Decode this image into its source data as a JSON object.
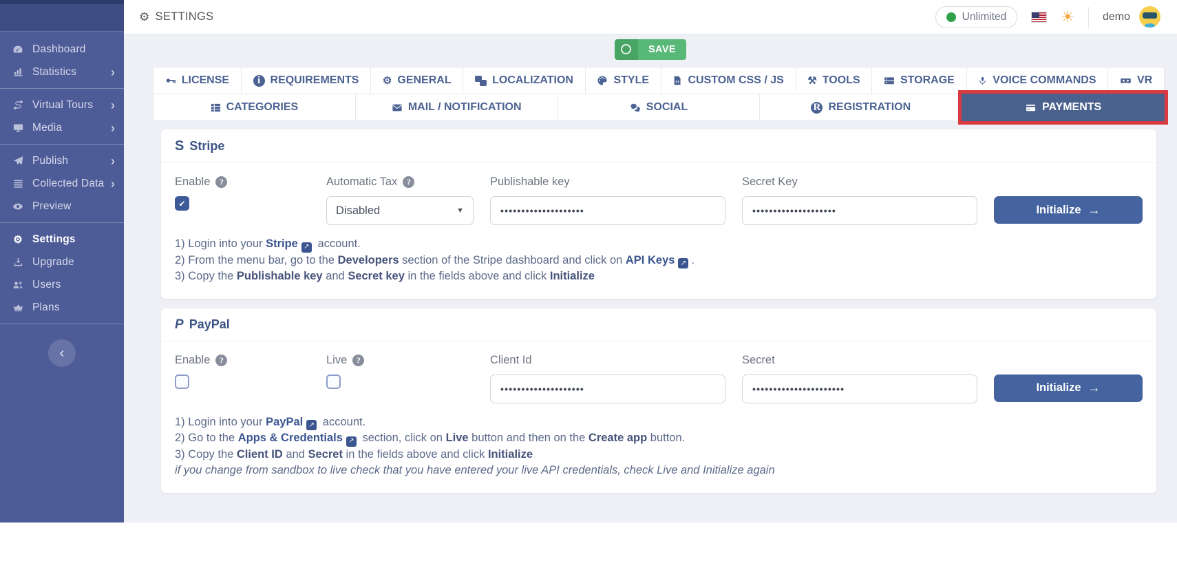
{
  "app": {
    "title": "SETTINGS"
  },
  "colors": {
    "sidebar_bg": "#4d5b97",
    "accent_blue": "#45639e",
    "active_tab_bg": "#4a618e",
    "highlight_red": "#d93a40",
    "save_green": "#57b878",
    "badge_green": "#31a24c",
    "sun_orange": "#f0a63c"
  },
  "header": {
    "plan_badge": "Unlimited",
    "username": "demo",
    "icons": [
      "flag-us-icon",
      "sun-icon",
      "avatar"
    ]
  },
  "toolbar": {
    "save_label": "SAVE",
    "save_icon": "circle-outline-icon"
  },
  "sidebar": {
    "items": [
      {
        "label": "Dashboard",
        "icon": "dashboard-icon",
        "has_submenu": false,
        "active": false
      },
      {
        "label": "Statistics",
        "icon": "statistics-icon",
        "has_submenu": true,
        "active": false
      },
      {
        "label": "Virtual Tours",
        "icon": "route-icon",
        "has_submenu": true,
        "active": false
      },
      {
        "label": "Media",
        "icon": "monitor-icon",
        "has_submenu": true,
        "active": false
      },
      {
        "label": "Publish",
        "icon": "paper-plane-icon",
        "has_submenu": true,
        "active": false
      },
      {
        "label": "Collected Data",
        "icon": "list-icon",
        "has_submenu": true,
        "active": false
      },
      {
        "label": "Preview",
        "icon": "eye-icon",
        "has_submenu": false,
        "active": false
      },
      {
        "label": "Settings",
        "icon": "gears-icon",
        "has_submenu": false,
        "active": true
      },
      {
        "label": "Upgrade",
        "icon": "download-icon",
        "has_submenu": false,
        "active": false
      },
      {
        "label": "Users",
        "icon": "users-icon",
        "has_submenu": false,
        "active": false
      },
      {
        "label": "Plans",
        "icon": "crown-icon",
        "has_submenu": false,
        "active": false
      }
    ],
    "chevron_glyph": "›",
    "collapse_glyph": "‹"
  },
  "tabs_row1": [
    {
      "label": "LICENSE",
      "icon": "key-icon"
    },
    {
      "label": "REQUIREMENTS",
      "icon": "info-circle-icon"
    },
    {
      "label": "GENERAL",
      "icon": "gears-icon"
    },
    {
      "label": "LOCALIZATION",
      "icon": "language-icon"
    },
    {
      "label": "STYLE",
      "icon": "palette-icon"
    },
    {
      "label": "CUSTOM CSS / JS",
      "icon": "file-code-icon"
    },
    {
      "label": "TOOLS",
      "icon": "tools-icon"
    },
    {
      "label": "STORAGE",
      "icon": "server-icon"
    },
    {
      "label": "VOICE COMMANDS",
      "icon": "microphone-icon"
    },
    {
      "label": "VR",
      "icon": "vr-headset-icon"
    }
  ],
  "tabs_row2": [
    {
      "label": "CATEGORIES",
      "icon": "grid-list-icon",
      "active": false
    },
    {
      "label": "MAIL / NOTIFICATION",
      "icon": "mail-icon",
      "active": false
    },
    {
      "label": "SOCIAL",
      "icon": "comments-icon",
      "active": false
    },
    {
      "label": "REGISTRATION",
      "icon": "registered-icon",
      "active": false
    },
    {
      "label": "PAYMENTS",
      "icon": "credit-card-icon",
      "active": true,
      "highlight": "red-annotation-ring"
    }
  ],
  "stripe": {
    "title": "Stripe",
    "enable_label": "Enable",
    "enable_checked": true,
    "automatic_tax_label": "Automatic Tax",
    "automatic_tax_value": "Disabled",
    "publishable_key_label": "Publishable key",
    "publishable_key_value": "••••••••••••••••••••",
    "secret_key_label": "Secret Key",
    "secret_key_value": "••••••••••••••••••••",
    "initialize_label": "Initialize",
    "step1": {
      "pre": "1) Login into your ",
      "link": "Stripe",
      "post": " account."
    },
    "step2": {
      "pre": "2) From the menu bar, go to the ",
      "bold": "Developers",
      "mid": " section of the Stripe dashboard and click on ",
      "link": "API Keys",
      "post": "."
    },
    "step3": {
      "pre": "3) Copy the ",
      "bold1": "Publishable key",
      "mid1": " and ",
      "bold2": "Secret key",
      "mid2": " in the fields above and click ",
      "bold3": "Initialize"
    }
  },
  "paypal": {
    "title": "PayPal",
    "enable_label": "Enable",
    "enable_checked": false,
    "live_label": "Live",
    "live_checked": false,
    "client_id_label": "Client Id",
    "client_id_value": "••••••••••••••••••••",
    "secret_label": "Secret",
    "secret_value": "••••••••••••••••••••••",
    "initialize_label": "Initialize",
    "step1": {
      "pre": "1) Login into your ",
      "link": "PayPal",
      "post": " account."
    },
    "step2": {
      "pre": "2) Go to the ",
      "link": "Apps & Credentials",
      "mid": " section, click on ",
      "bold1": "Live",
      "mid2": " button and then on the ",
      "bold2": "Create app",
      "post": " button."
    },
    "step3": {
      "pre": "3) Copy the ",
      "bold1": "Client ID",
      "mid1": " and ",
      "bold2": "Secret",
      "mid2": " in the fields above and click ",
      "bold3": "Initialize"
    },
    "note": "if you change from sandbox to live check that you have entered your live API credentials, check Live and Initialize again"
  }
}
